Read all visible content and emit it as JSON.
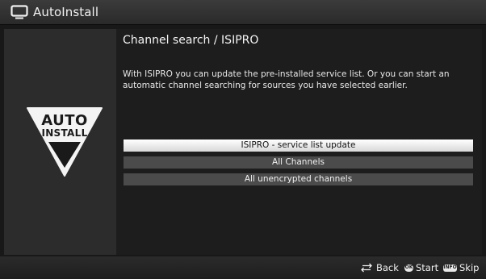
{
  "header": {
    "title": "AutoInstall",
    "icon": "tv-icon"
  },
  "logo": {
    "line1": "AUTO",
    "line2": "INSTALL"
  },
  "main": {
    "title": "Channel search / ISIPRO",
    "description": "With ISIPRO you can update the pre-installed service list. Or you can start an automatic channel searching for sources you have selected earlier.",
    "options": [
      {
        "label": "ISIPRO - service list update",
        "selected": true
      },
      {
        "label": "All Channels",
        "selected": false
      },
      {
        "label": "All unencrypted channels",
        "selected": false
      }
    ]
  },
  "footer": {
    "back_label": "Back",
    "ok_key": "OK",
    "start_label": "Start",
    "info_key": "INFO",
    "skip_label": "Skip"
  },
  "colors": {
    "background": "#181818",
    "panel": "#2c2c2c",
    "option": "#4b4b4b",
    "selected": "#ffffff",
    "text": "#f0f0f0"
  }
}
